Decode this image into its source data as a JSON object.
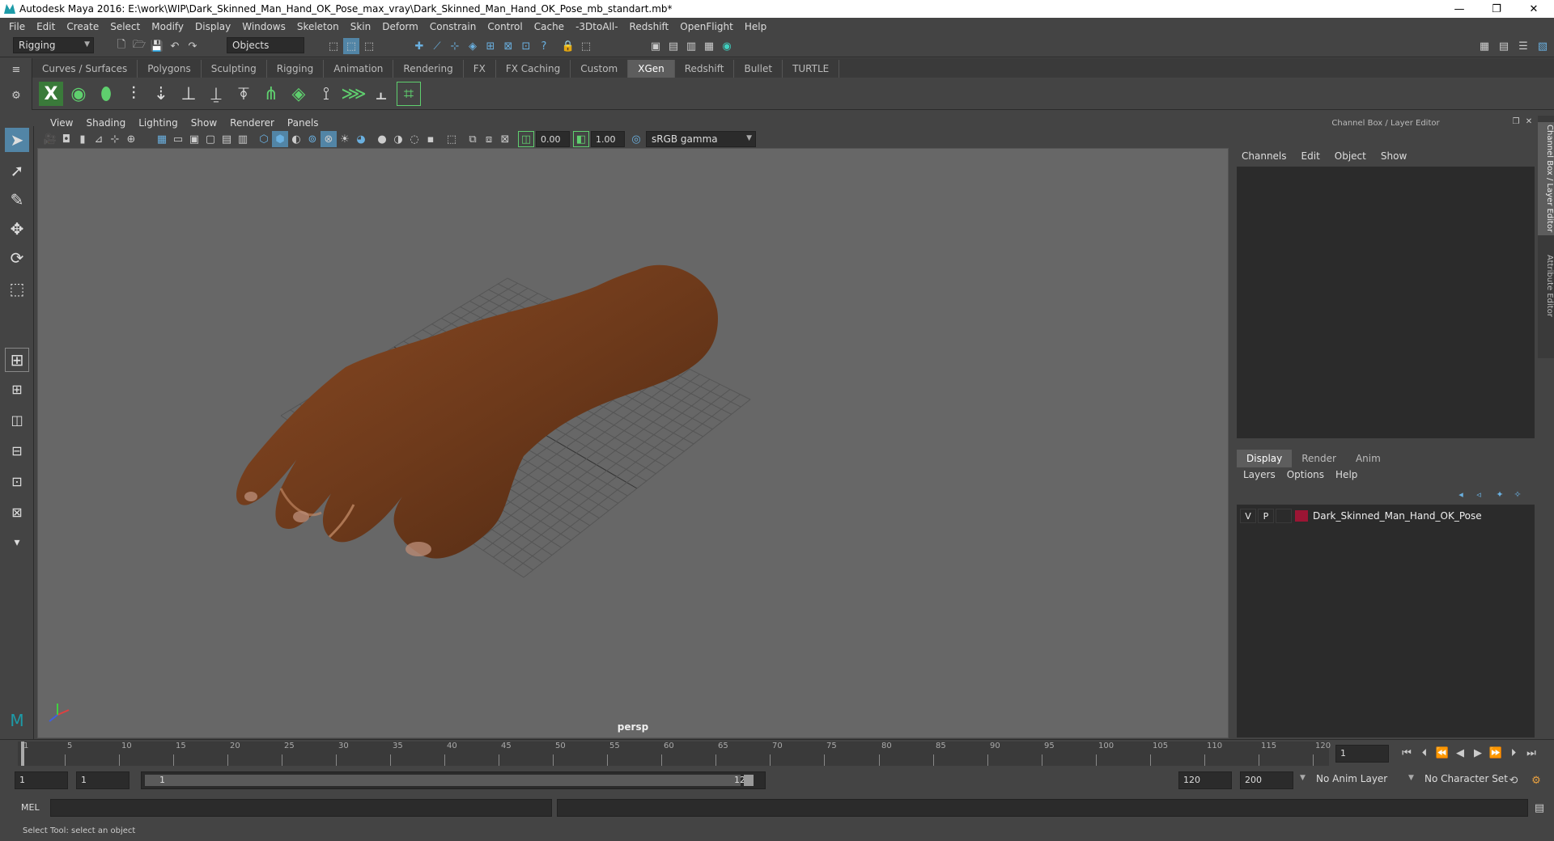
{
  "window": {
    "title": "Autodesk Maya 2016: E:\\work\\WIP\\Dark_Skinned_Man_Hand_OK_Pose_max_vray\\Dark_Skinned_Man_Hand_OK_Pose_mb_standart.mb*",
    "minimize": "—",
    "restore": "❐",
    "close": "✕"
  },
  "menubar": [
    "File",
    "Edit",
    "Create",
    "Select",
    "Modify",
    "Display",
    "Windows",
    "Skeleton",
    "Skin",
    "Deform",
    "Constrain",
    "Control",
    "Cache",
    "-3DtoAll-",
    "Redshift",
    "OpenFlight",
    "Help"
  ],
  "statusline": {
    "mode": "Rigging",
    "select_mode": "Objects"
  },
  "shelf_tabs": [
    "Curves / Surfaces",
    "Polygons",
    "Sculpting",
    "Rigging",
    "Animation",
    "Rendering",
    "FX",
    "FX Caching",
    "Custom",
    "XGen",
    "Redshift",
    "Bullet",
    "TURTLE"
  ],
  "shelf_active": "XGen",
  "viewport": {
    "menu": [
      "View",
      "Shading",
      "Lighting",
      "Show",
      "Renderer",
      "Panels"
    ],
    "exposure": "0.00",
    "gamma": "1.00",
    "color_space": "sRGB gamma",
    "camera": "persp"
  },
  "channel_box": {
    "header": "Channel Box / Layer Editor",
    "menu": [
      "Channels",
      "Edit",
      "Object",
      "Show"
    ]
  },
  "layer_editor": {
    "tabs": [
      "Display",
      "Render",
      "Anim"
    ],
    "active_tab": "Display",
    "menu": [
      "Layers",
      "Options",
      "Help"
    ],
    "layers": [
      {
        "v": "V",
        "p": "P",
        "color": "#9b1534",
        "name": "Dark_Skinned_Man_Hand_OK_Pose"
      }
    ]
  },
  "side_tabs": [
    "Channel Box / Layer Editor",
    "Attribute Editor"
  ],
  "timeline": {
    "ticks": [
      "1",
      "5",
      "10",
      "15",
      "20",
      "25",
      "30",
      "35",
      "40",
      "45",
      "50",
      "55",
      "60",
      "65",
      "70",
      "75",
      "80",
      "85",
      "90",
      "95",
      "100",
      "105",
      "110",
      "115",
      "120"
    ],
    "current_frame": "1"
  },
  "range": {
    "start": "1",
    "range_start": "1",
    "slider_start": "1",
    "slider_end": "120",
    "range_end": "120",
    "end": "200",
    "anim_layer": "No Anim Layer",
    "character_set": "No Character Set"
  },
  "command_line": {
    "label": "MEL"
  },
  "help_line": "Select Tool: select an object"
}
